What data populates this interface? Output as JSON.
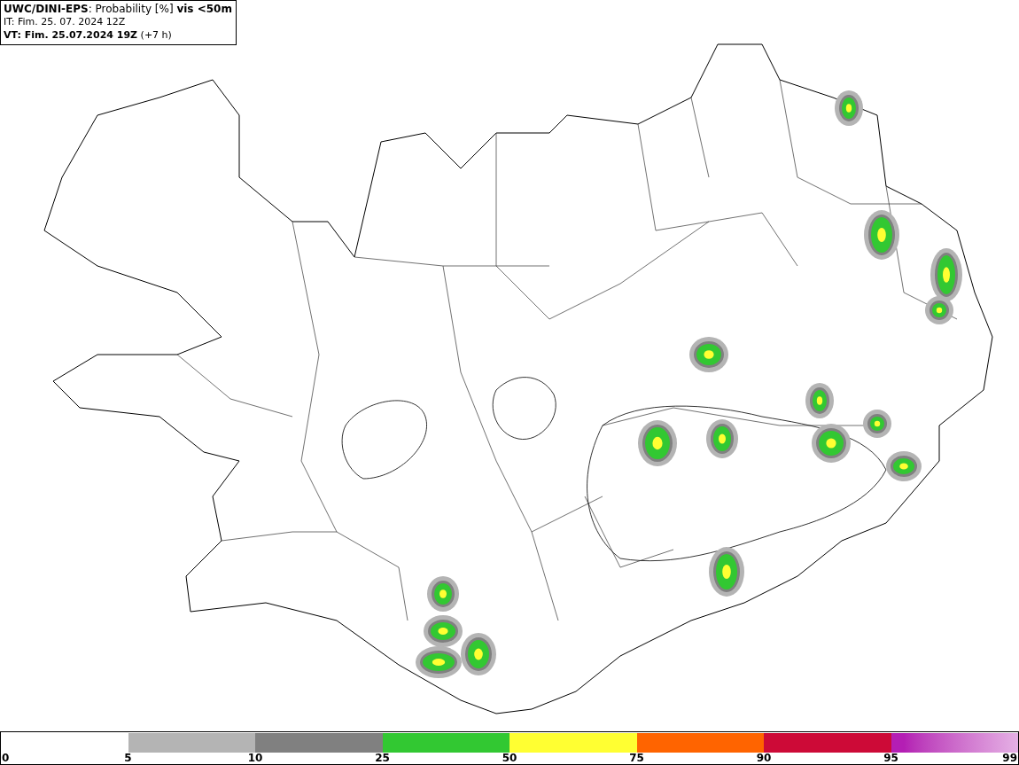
{
  "header": {
    "title": "**UWC/DINI-EPS**: Probability [%] **vis <50m**",
    "issue_time": "IT: Fim. 25. 07. 2024 12Z",
    "valid_time": "**VT: Fim. 25.07.2024 19Z** (+7 h)"
  },
  "legend": {
    "bands": [
      {
        "kind": "solid",
        "color": "#ffffff"
      },
      {
        "kind": "solid",
        "color": "#b4b4b4"
      },
      {
        "kind": "solid",
        "color": "#808080"
      },
      {
        "kind": "solid",
        "color": "#32c832"
      },
      {
        "kind": "solid",
        "color": "#ffff32"
      },
      {
        "kind": "solid",
        "color": "#ff6400"
      },
      {
        "kind": "solid",
        "color": "#cd0a37"
      },
      {
        "kind": "gradient",
        "color": "#b41eb4"
      }
    ],
    "labels": [
      "0",
      "5",
      "10",
      "25",
      "50",
      "75",
      "90",
      "95",
      "99"
    ]
  }
}
